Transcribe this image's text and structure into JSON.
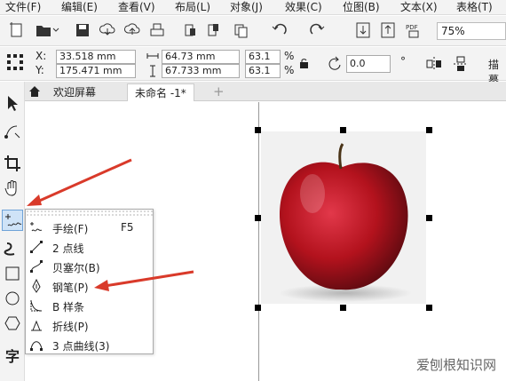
{
  "menu": [
    "文件(F)",
    "编辑(E)",
    "查看(V)",
    "布局(L)",
    "对象(J)",
    "效果(C)",
    "位图(B)",
    "文本(X)",
    "表格(T)"
  ],
  "toolbar": {
    "zoom": "75%"
  },
  "propbar": {
    "x_label": "X:",
    "x_value": "33.518 mm",
    "y_label": "Y:",
    "y_value": "175.471 mm",
    "w_value": "64.73 mm",
    "h_value": "67.733 mm",
    "scale_w": "63.1",
    "scale_h": "63.1",
    "pct": "%",
    "rotate_value": "0.0",
    "rotate_unit": "°",
    "trace_label": "描摹"
  },
  "tabs": [
    {
      "label": "欢迎屏幕"
    },
    {
      "label": "未命名 -1*"
    }
  ],
  "flyout": {
    "items": [
      {
        "label": "手绘(F)",
        "shortcut": "F5"
      },
      {
        "label": "2 点线",
        "shortcut": ""
      },
      {
        "label": "贝塞尔(B)",
        "shortcut": ""
      },
      {
        "label": "钢笔(P)",
        "shortcut": ""
      },
      {
        "label": "B 样条",
        "shortcut": ""
      },
      {
        "label": "折线(P)",
        "shortcut": ""
      },
      {
        "label": "3 点曲线(3)",
        "shortcut": ""
      }
    ]
  },
  "toolbox_text_tool": "字",
  "watermark": "爱刨根知识网",
  "colors": {
    "accent": "#cfe3f7",
    "arrow": "#d93a2a",
    "apple": "#b3121d"
  }
}
